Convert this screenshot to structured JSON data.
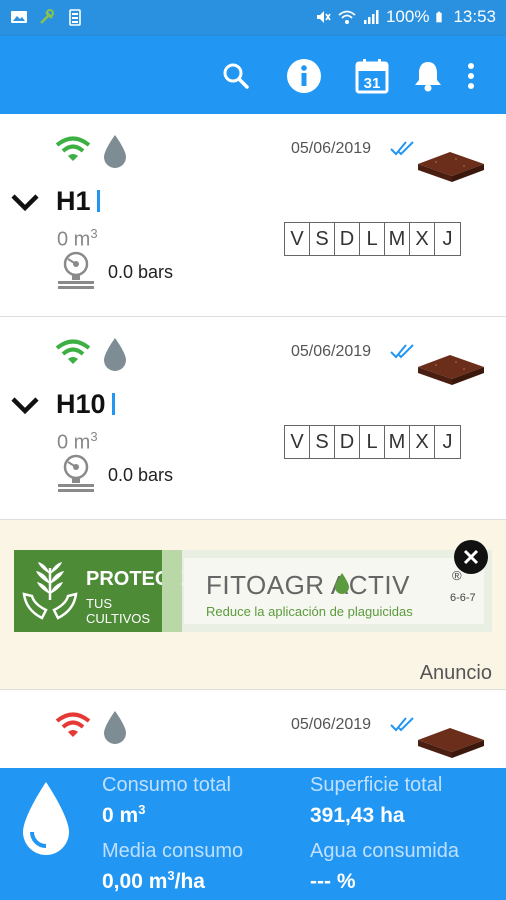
{
  "status_bar": {
    "battery": "100%",
    "time": "13:53"
  },
  "toolbar": {
    "calendar_day": "31"
  },
  "items": [
    {
      "date": "05/06/2019",
      "name": "H1",
      "volume": "0 m",
      "volume_unit_sup": "3",
      "pressure": "0.0 bars",
      "wifi_color": "#3cb043",
      "days": [
        "V",
        "S",
        "D",
        "L",
        "M",
        "X",
        "J"
      ]
    },
    {
      "date": "05/06/2019",
      "name": "H10",
      "volume": "0 m",
      "volume_unit_sup": "3",
      "pressure": "0.0 bars",
      "wifi_color": "#3cb043",
      "days": [
        "V",
        "S",
        "D",
        "L",
        "M",
        "X",
        "J"
      ]
    },
    {
      "date": "05/06/2019",
      "wifi_color": "#e53935"
    }
  ],
  "ad": {
    "headline": "PROTEGE",
    "subline": "TUS CULTIVOS",
    "brand": "FITOAGR ACTIV",
    "tagline": "Reduce la aplicación de plaguicidas",
    "npk": "6-6-7",
    "registered": "®",
    "label": "Anuncio"
  },
  "footer": {
    "consumo_total_label": "Consumo total",
    "consumo_total_value": "0 m",
    "consumo_total_sup": "3",
    "superficie_total_label": "Superficie total",
    "superficie_total_value": "391,43 ha",
    "media_consumo_label": "Media consumo",
    "media_consumo_value": "0,00 m",
    "media_consumo_sup": "3",
    "media_consumo_suffix": "/ha",
    "agua_consumida_label": "Agua consumida",
    "agua_consumida_value": "--- %"
  },
  "colors": {
    "primary": "#2196f3",
    "status_bar": "#2a90e0",
    "ad_background": "#fbf5e6",
    "soil": "#6b2e1a"
  }
}
